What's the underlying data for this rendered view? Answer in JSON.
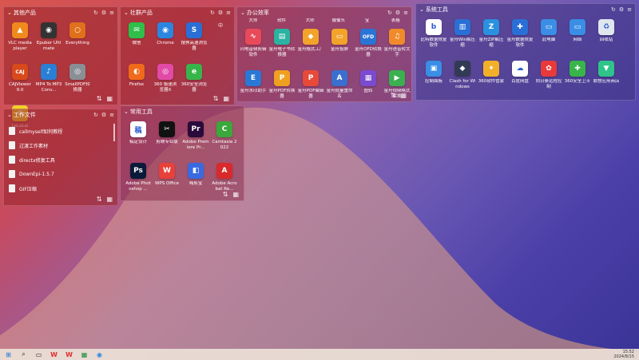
{
  "theme": {
    "panel_red": "#962328",
    "panel_blue": "#3c3282",
    "wave_color": "#c9a0a8"
  },
  "panels": {
    "other": {
      "title": "其他产品",
      "col_labels": [
        "",
        "",
        ""
      ],
      "apps": [
        {
          "label": "VLC media player",
          "icon": "vlc-icon",
          "color": "#f08a1c",
          "glyph": "▲"
        },
        {
          "label": "Epubor Ultimate",
          "icon": "epubor-icon",
          "color": "#333333",
          "glyph": "◉"
        },
        {
          "label": "Everything",
          "icon": "everything-icon",
          "color": "#e0701c",
          "glyph": "○"
        },
        {
          "label": "CAJViewer 9.0",
          "icon": "cajviewer-icon",
          "color": "#d84a1c",
          "glyph": "CAJ"
        },
        {
          "label": "MP4 To MP3 Conv...",
          "icon": "mp4-to-mp3-icon",
          "color": "#2a7fd4",
          "glyph": "♪"
        },
        {
          "label": "SmallPDF转换器",
          "icon": "smallpdf-icon",
          "color": "#8a8f96",
          "glyph": "◎"
        },
        {
          "label": "LaLaLai",
          "icon": "lalalai-icon",
          "color": "#f2d12a",
          "glyph": "≡"
        }
      ]
    },
    "social": {
      "title": "社群产品",
      "col_labels": [
        "",
        "",
        "",
        "中"
      ],
      "apps": [
        {
          "label": "微信",
          "icon": "wechat-icon",
          "color": "#2fbf4a",
          "glyph": "✉"
        },
        {
          "label": "Chrome",
          "icon": "chrome-icon",
          "color": "#2c86e0",
          "glyph": "◉"
        },
        {
          "label": "搜狗高速浏览器",
          "icon": "sogou-browser-icon",
          "color": "#2a6fd6",
          "glyph": "S"
        },
        {
          "label": "Firefox",
          "icon": "firefox-icon",
          "color": "#f06a1c",
          "glyph": "◐"
        },
        {
          "label": "360 极速浏览器X",
          "icon": "360-browser-icon",
          "color": "#e24aa8",
          "glyph": "◎"
        },
        {
          "label": "360安全浏览器",
          "icon": "360-safe-browser-icon",
          "color": "#38b54a",
          "glyph": "e"
        }
      ]
    },
    "office": {
      "title": "办公效率",
      "col_labels": [
        "大师",
        "软件",
        "大师",
        "摄像头",
        "宝",
        "",
        "",
        "表格"
      ],
      "apps": [
        {
          "label": "闪电音频剪辑软件",
          "icon": "audio-editor-icon",
          "color": "#e84a5a",
          "glyph": "∿"
        },
        {
          "label": "金舟电子书转换器",
          "icon": "ebook-converter-icon",
          "color": "#2ab3a0",
          "glyph": "▤"
        },
        {
          "label": "金舟格式工厂",
          "icon": "format-factory-icon",
          "color": "#f2a32a",
          "glyph": "◆"
        },
        {
          "label": "金舟投屏",
          "icon": "screen-cast-icon",
          "color": "#f2a32a",
          "glyph": "▭"
        },
        {
          "label": "金舟OFD转换器",
          "icon": "ofd-converter-icon",
          "color": "#2a74d6",
          "glyph": "OFD"
        },
        {
          "label": "金舟语音转文字",
          "icon": "voice-to-text-icon",
          "color": "#f08a2a",
          "glyph": "♫"
        },
        {
          "label": "金舟水印助手",
          "icon": "watermark-icon",
          "color": "#2a78d6",
          "glyph": "E"
        },
        {
          "label": "金舟PDF转换器",
          "icon": "pdf-converter-icon",
          "color": "#f0a020",
          "glyph": "P"
        },
        {
          "label": "金舟PDF编辑器",
          "icon": "pdf-editor-icon",
          "color": "#e84a3a",
          "glyph": "P"
        },
        {
          "label": "金舟批量重命名",
          "icon": "batch-rename-icon",
          "color": "#3a6fd0",
          "glyph": "A"
        },
        {
          "label": "图转",
          "icon": "image-convert-icon",
          "color": "#7a4ad0",
          "glyph": "▦"
        },
        {
          "label": "金舟视频格式转换",
          "icon": "video-converter-icon",
          "color": "#3ab050",
          "glyph": "▶"
        }
      ]
    },
    "system": {
      "title": "系统工具",
      "apps": [
        {
          "label": "比特数据恢复软件",
          "icon": "data-recovery-icon",
          "color": "#ffffff",
          "glyph": "b",
          "dark": true
        },
        {
          "label": "金舟Win解压缩",
          "icon": "win-unzip-icon",
          "color": "#2a6fd6",
          "glyph": "▥"
        },
        {
          "label": "金舟ZIP解压缩",
          "icon": "zip-icon",
          "color": "#2a90e0",
          "glyph": "Z"
        },
        {
          "label": "金舟数据恢复软件",
          "icon": "recovery-icon",
          "color": "#2a6fd6",
          "glyph": "✚"
        },
        {
          "label": "此电脑",
          "icon": "this-pc-icon",
          "color": "#3a8ee6",
          "glyph": "▭"
        },
        {
          "label": "网络",
          "icon": "network-icon",
          "color": "#3a8ee6",
          "glyph": "▭"
        },
        {
          "label": "回收站",
          "icon": "recycle-bin-icon",
          "color": "#dfe6ee",
          "glyph": "♻",
          "dark": true
        },
        {
          "label": "控制面板",
          "icon": "control-panel-icon",
          "color": "#3a8ee6",
          "glyph": "▣"
        },
        {
          "label": "Clash for Windows",
          "icon": "clash-icon",
          "color": "#333a55",
          "glyph": "◆"
        },
        {
          "label": "360软件管家",
          "icon": "360-manager-icon",
          "color": "#f2b02a",
          "glyph": "✦"
        },
        {
          "label": "百度网盘",
          "icon": "baidu-pan-icon",
          "color": "#ffffff",
          "glyph": "☁",
          "dark": true
        },
        {
          "label": "向日葵远程控制",
          "icon": "sunlogin-icon",
          "color": "#e83a3a",
          "glyph": "✿"
        },
        {
          "label": "360安全卫士",
          "icon": "360-safe-icon",
          "color": "#38b54a",
          "glyph": "✚"
        },
        {
          "label": "联想应用商店",
          "icon": "lenovo-store-icon",
          "color": "#2ec48a",
          "glyph": "▼"
        }
      ]
    },
    "work": {
      "title": "工作文件",
      "files": [
        {
          "label": "callmyself如何教程"
        },
        {
          "label": "过渡工作素材"
        },
        {
          "label": "directx修复工具"
        },
        {
          "label": "DownEpi-1.5.7"
        },
        {
          "label": "GIF压缩"
        }
      ]
    },
    "common": {
      "title": "常用工具",
      "apps": [
        {
          "label": "稿定设计",
          "icon": "gaoding-icon",
          "color": "#ffffff",
          "glyph": "稿",
          "dark": true
        },
        {
          "label": "剪映专业版",
          "icon": "capcut-icon",
          "color": "#111111",
          "glyph": "✂"
        },
        {
          "label": "Adobe Premiere Pr...",
          "icon": "premiere-icon",
          "color": "#2a0a3a",
          "glyph": "Pr"
        },
        {
          "label": "Camtasia 2022",
          "icon": "camtasia-icon",
          "color": "#3aa83a",
          "glyph": "C"
        },
        {
          "label": "Adobe Photoshop ...",
          "icon": "photoshop-icon",
          "color": "#0a1a3a",
          "glyph": "Ps"
        },
        {
          "label": "WPS Office",
          "icon": "wps-icon",
          "color": "#e8403a",
          "glyph": "W"
        },
        {
          "label": "嗨剪宝",
          "icon": "haijian-icon",
          "color": "#3a6ae0",
          "glyph": "◧"
        },
        {
          "label": "Adobe Acrobat Re...",
          "icon": "acrobat-icon",
          "color": "#d82a2a",
          "glyph": "A"
        }
      ]
    }
  },
  "taskbar": {
    "time": "15:52",
    "date": "2024/8/15"
  }
}
